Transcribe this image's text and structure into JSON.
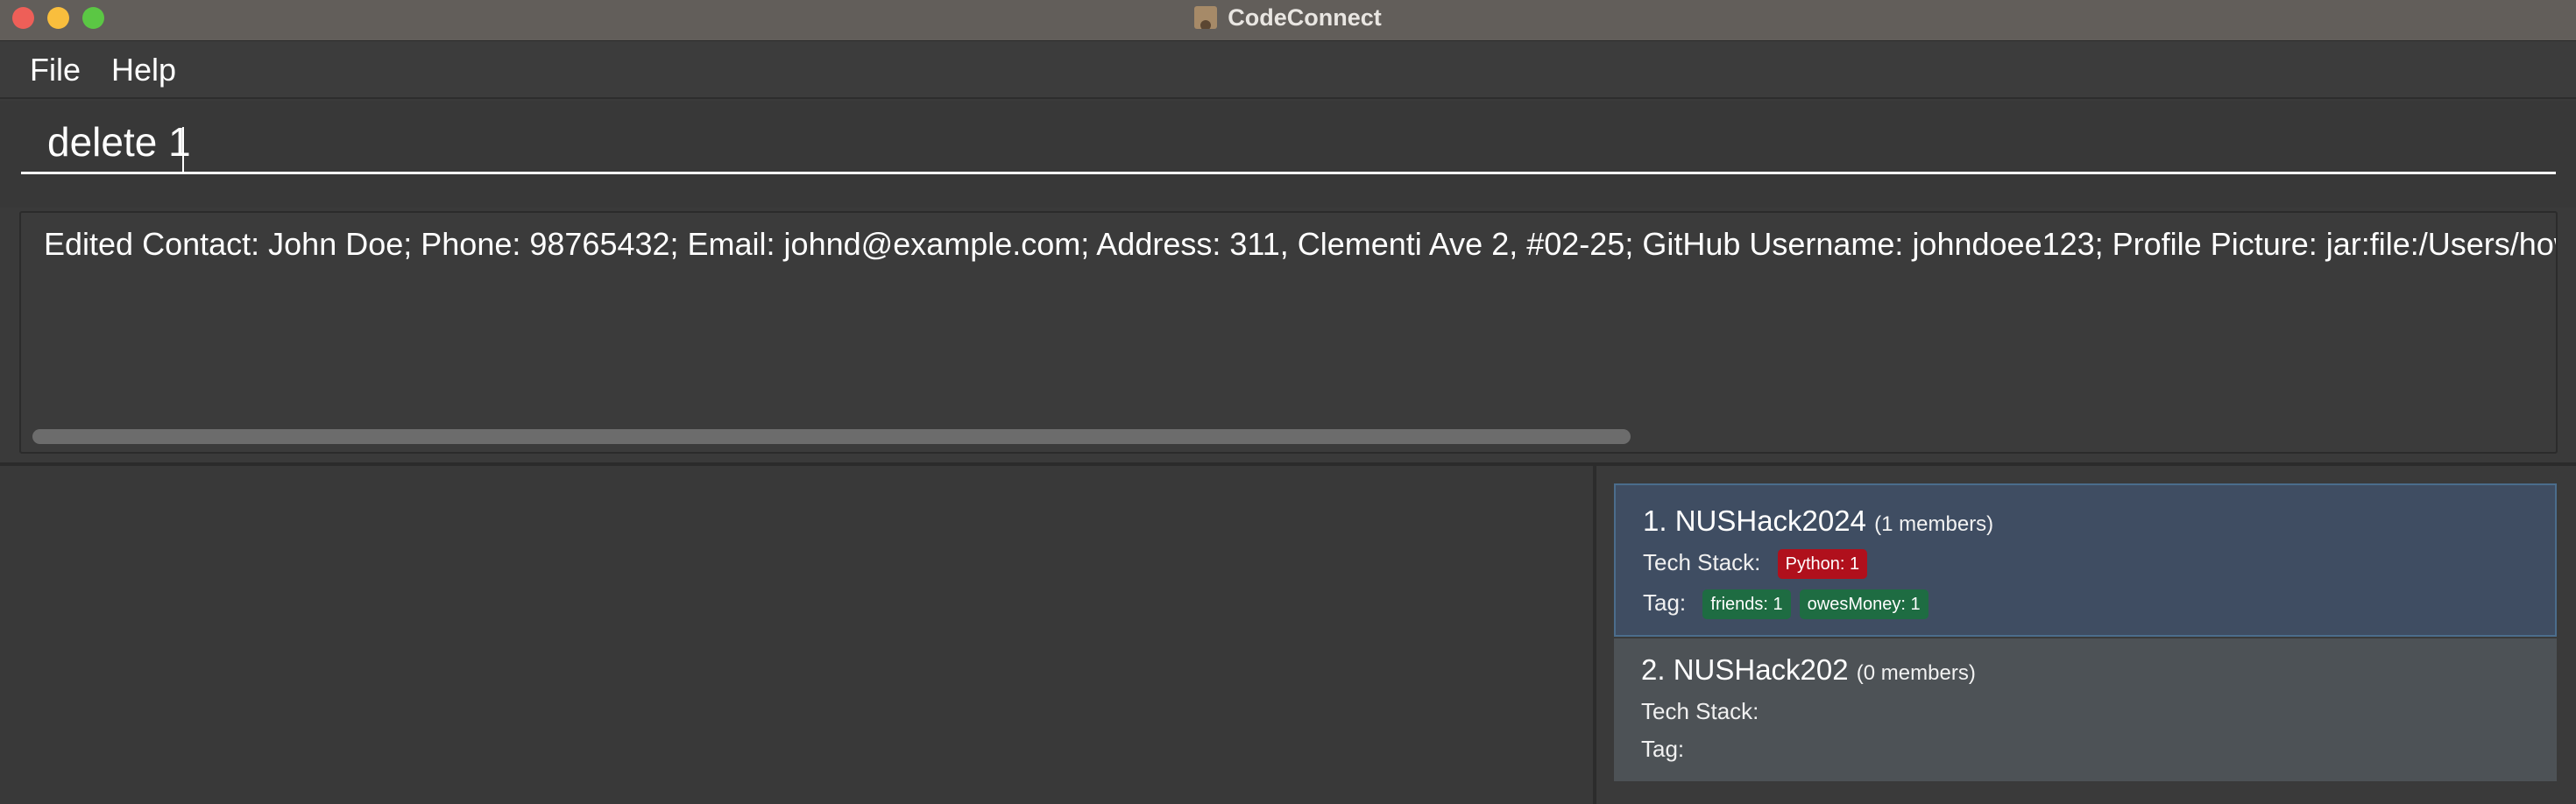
{
  "window": {
    "title": "CodeConnect",
    "icon": "contact-book-icon"
  },
  "menu": {
    "file_label": "File",
    "help_label": "Help"
  },
  "command": {
    "value": "delete 1"
  },
  "result": {
    "text": "Edited Contact: John Doe; Phone: 98765432; Email: johnd@example.com; Address: 311, Clementi Ave 2, #02-25; GitHub Username: johndoee123; Profile Picture: jar:file:/Users/howen/D"
  },
  "groups": [
    {
      "index": "1.",
      "name": "NUSHack2024",
      "members": "(1 members)",
      "tech_stack_label": "Tech Stack:",
      "tech_stack": [
        "Python: 1"
      ],
      "tag_label": "Tag:",
      "tags": [
        "friends: 1",
        "owesMoney: 1"
      ],
      "selected": true
    },
    {
      "index": "2.",
      "name": "NUSHack202",
      "members": "(0 members)",
      "tech_stack_label": "Tech Stack:",
      "tech_stack": [],
      "tag_label": "Tag:",
      "tags": [],
      "selected": false
    }
  ],
  "colors": {
    "tech_chip": "#b0101c",
    "tag_chip": "#1e6c42",
    "selected_card": "#3f4d62",
    "card": "#4d5256"
  }
}
